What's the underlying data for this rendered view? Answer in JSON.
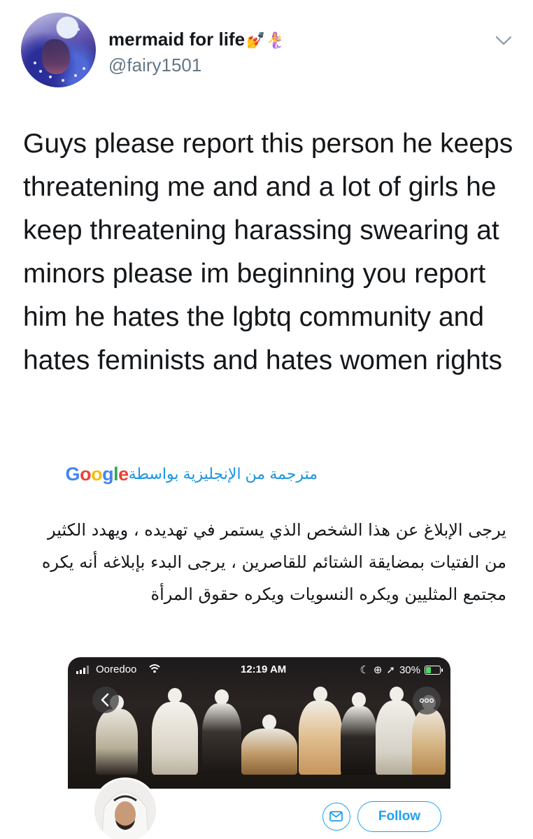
{
  "author": {
    "display_name": "mermaid for life",
    "name_emoji": "💅🧜‍♀️",
    "handle": "@fairy1501"
  },
  "tweet": {
    "text": "Guys please report this person he keeps threatening me and and a lot of girls he keep threatening harassing swearing at minors please im beginning you report him he hates the lgbtq community and hates feminists and hates women rights",
    "translated_by_label": "مترجمة من الإنجليزية بواسطة",
    "translation_service": "Google",
    "translation": "يرجى الإبلاغ عن هذا الشخص الذي يستمر في تهديده ، ويهدد الكثير من الفتيات بمضايقة الشتائم للقاصرين ، يرجى البدء بإبلاغه أنه يكره مجتمع المثليين ويكره النسويات ويكره حقوق المرأة"
  },
  "embedded_screenshot": {
    "status_bar": {
      "carrier": "Ooredoo",
      "time": "12:19 AM",
      "battery": "30%"
    },
    "follow_label": "Follow"
  },
  "colors": {
    "twitter_blue": "#1da1f2",
    "link_blue": "#1b95e0",
    "secondary_text": "#657786",
    "primary_text": "#14171a"
  },
  "icons": [
    "chevron-down-icon",
    "signal-icon",
    "wifi-icon",
    "moon-icon",
    "location-arrow-icon",
    "battery-icon",
    "back-icon",
    "more-icon",
    "mail-icon"
  ]
}
